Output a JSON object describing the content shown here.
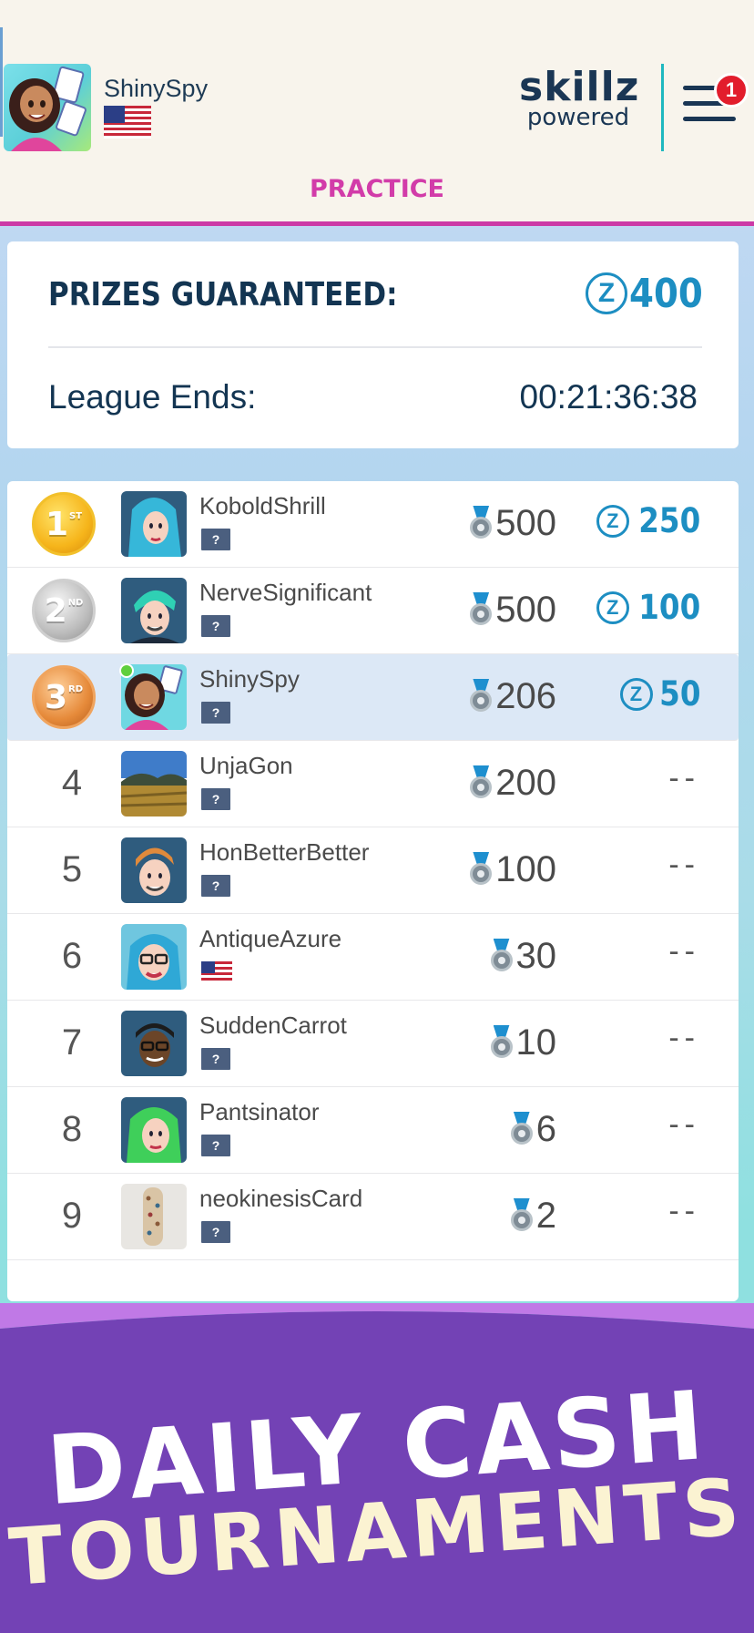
{
  "header": {
    "username": "ShinySpy",
    "logo_line1": "skillz",
    "logo_line2": "powered",
    "menu_badge": "1",
    "mode": "PRACTICE"
  },
  "prizes": {
    "label": "PRIZES GUARANTEED:",
    "currency_symbol": "Z",
    "amount": "400",
    "league_label": "League Ends:",
    "league_timer": "00:21:36:38"
  },
  "leaderboard": {
    "unknown_flag": "?",
    "currency_symbol": "Z",
    "no_prize": "--",
    "rows": [
      {
        "rank": "1",
        "medal": "gold",
        "medal_suffix": "ST",
        "name": "KoboldShrill",
        "score": "500",
        "payout": "250"
      },
      {
        "rank": "2",
        "medal": "silver",
        "medal_suffix": "ND",
        "name": "NerveSignificant",
        "score": "500",
        "payout": "100"
      },
      {
        "rank": "3",
        "medal": "bronze",
        "medal_suffix": "RD",
        "name": "ShinySpy",
        "score": "206",
        "payout": "50"
      },
      {
        "rank": "4",
        "name": "UnjaGon",
        "score": "200"
      },
      {
        "rank": "5",
        "name": "HonBetterBetter",
        "score": "100"
      },
      {
        "rank": "6",
        "name": "AntiqueAzure",
        "score": "30"
      },
      {
        "rank": "7",
        "name": "SuddenCarrot",
        "score": "10"
      },
      {
        "rank": "8",
        "name": "Pantsinator",
        "score": "6"
      },
      {
        "rank": "9",
        "name": "neokinesisCard",
        "score": "2"
      }
    ]
  },
  "banner": {
    "line1": "DAILY CASH",
    "line2": "TOURNAMENTS"
  },
  "colors": {
    "accent_pink": "#cc3aa6",
    "navy": "#133552",
    "z_blue": "#1d8ec2",
    "banner_purple": "#7342b5"
  }
}
